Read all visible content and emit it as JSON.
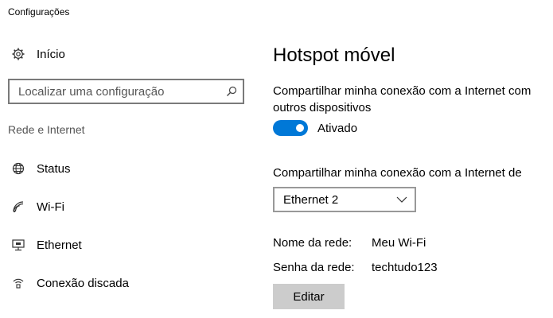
{
  "app": {
    "title": "Configurações"
  },
  "sidebar": {
    "home": {
      "label": "Início",
      "icon": "gear-icon"
    },
    "search": {
      "placeholder": "Localizar uma configuração",
      "icon": "search-icon"
    },
    "section_label": "Rede e Internet",
    "items": [
      {
        "label": "Status",
        "icon": "globe-icon"
      },
      {
        "label": "Wi-Fi",
        "icon": "wifi-icon"
      },
      {
        "label": "Ethernet",
        "icon": "ethernet-icon"
      },
      {
        "label": "Conexão discada",
        "icon": "dialup-icon"
      }
    ]
  },
  "main": {
    "title": "Hotspot móvel",
    "share_description": "Compartilhar minha conexão com a Internet com outros dispositivos",
    "toggle": {
      "state": "on",
      "label": "Ativado",
      "accent_color": "#0078d7"
    },
    "share_from_label": "Compartilhar minha conexão com a Internet de",
    "share_from_select": {
      "value": "Ethernet 2"
    },
    "network_name": {
      "label": "Nome da rede:",
      "value": "Meu Wi-Fi"
    },
    "network_password": {
      "label": "Senha da rede:",
      "value": "techtudo123"
    },
    "edit_button": "Editar"
  }
}
